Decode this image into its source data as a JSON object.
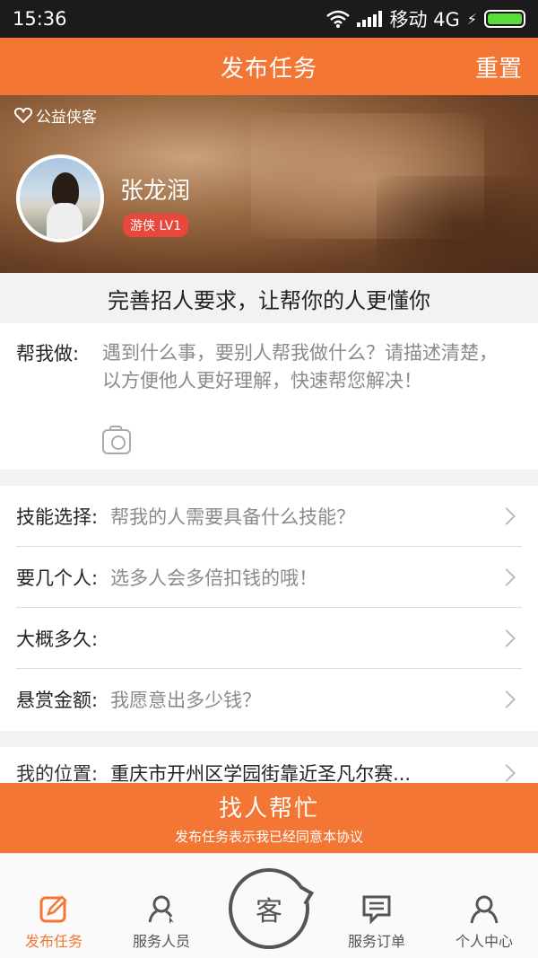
{
  "status_bar": {
    "time": "15:36",
    "carrier": "移动 4G"
  },
  "header": {
    "title": "发布任务",
    "reset_label": "重置"
  },
  "profile": {
    "tag": "公益侠客",
    "name": "张龙润",
    "level": "游侠 LV1"
  },
  "slogan": "完善招人要求，让帮你的人更懂你",
  "task": {
    "label": "帮我做:",
    "placeholder": "遇到什么事，要别人帮我做什么？请描述清楚，以方便他人更好理解，快速帮您解决！"
  },
  "form": {
    "rows": [
      {
        "label": "技能选择:",
        "value": "帮我的人需要具备什么技能？"
      },
      {
        "label": "要几个人:",
        "value": "选多人会多倍扣钱的哦！"
      },
      {
        "label": "大概多久:",
        "value": ""
      },
      {
        "label": "悬赏金额:",
        "value": "我愿意出多少钱？"
      }
    ]
  },
  "location": {
    "label": "我的位置:",
    "value": "重庆市开州区学园街靠近圣凡尔赛..."
  },
  "cta": {
    "label": "找人帮忙",
    "sub": "发布任务表示我已经同意本协议"
  },
  "tabs": [
    {
      "label": "发布任务",
      "icon": "edit-icon"
    },
    {
      "label": "服务人员",
      "icon": "person-search-icon"
    },
    {
      "label": "客",
      "icon": "refresh-ring-icon"
    },
    {
      "label": "服务订单",
      "icon": "chat-icon"
    },
    {
      "label": "个人中心",
      "icon": "person-icon"
    }
  ],
  "colors": {
    "accent": "#f37634",
    "badge": "#e8473b",
    "battery": "#5bdc3a"
  }
}
